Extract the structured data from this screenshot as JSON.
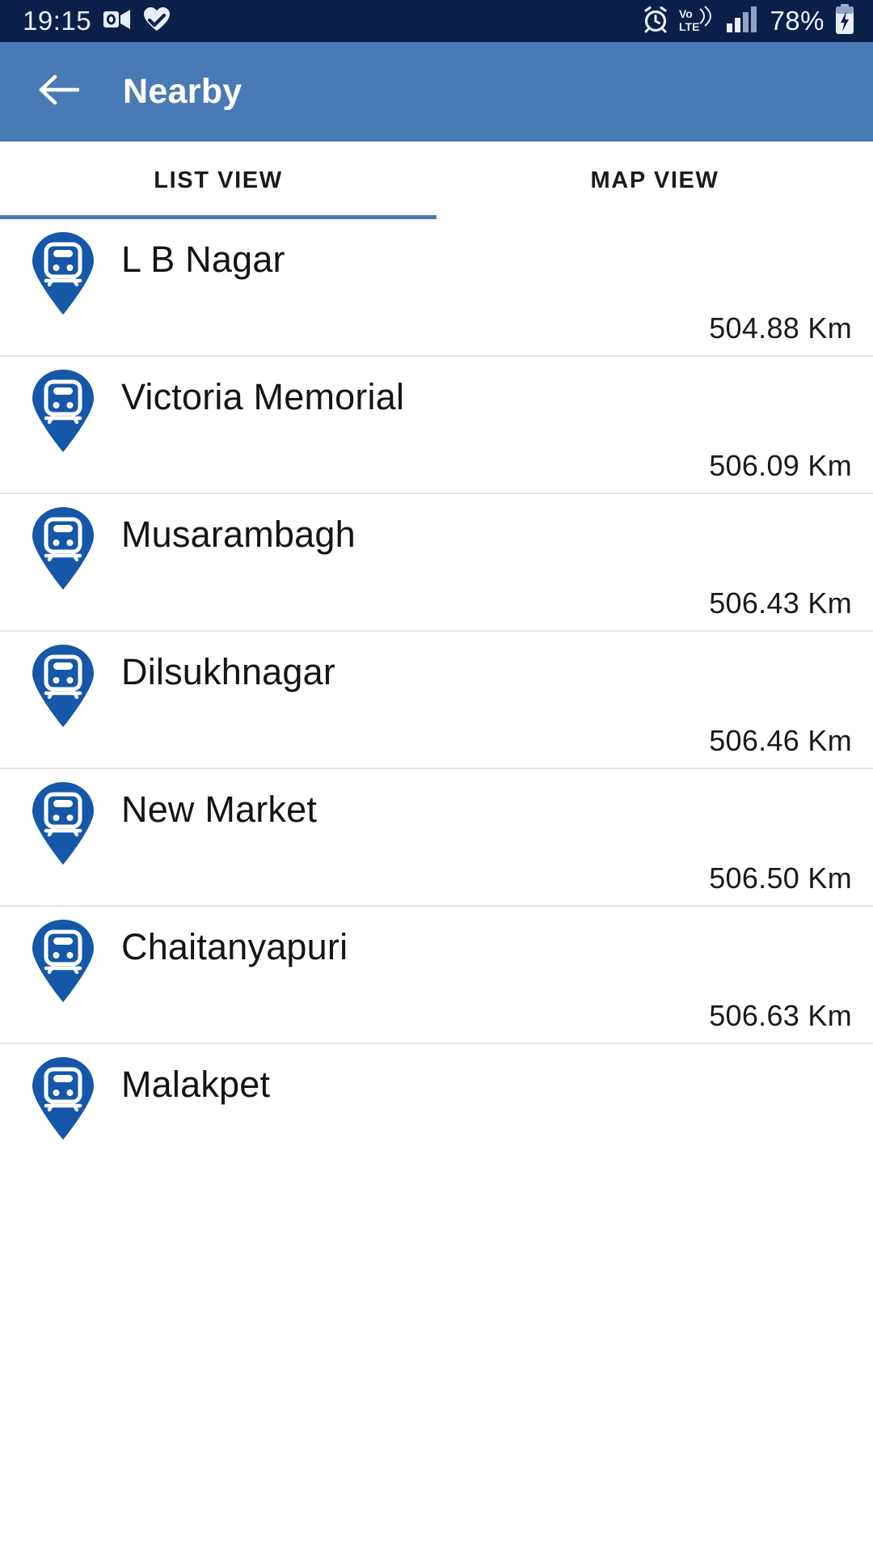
{
  "status_bar": {
    "time": "19:15",
    "battery_percent": "78%",
    "network_type": "Vo LTE",
    "icons": [
      "outlook-icon",
      "heart-health-icon",
      "alarm-icon",
      "volte-icon",
      "signal-bars-icon",
      "battery-charging-icon"
    ],
    "background_color": "#0b2049"
  },
  "app_bar": {
    "title": "Nearby",
    "back_icon": "back-arrow-icon",
    "background_color": "#4a7ab5"
  },
  "tabs": {
    "items": [
      {
        "label": "LIST VIEW",
        "selected": true
      },
      {
        "label": "MAP VIEW",
        "selected": false
      }
    ],
    "indicator_color": "#4a7ab5"
  },
  "list": {
    "pin_color": "#1557a8",
    "pin_icon": "metro-train-pin-icon",
    "items": [
      {
        "name": "L B Nagar",
        "distance": "504.88 Km"
      },
      {
        "name": "Victoria Memorial",
        "distance": "506.09 Km"
      },
      {
        "name": "Musarambagh",
        "distance": "506.43 Km"
      },
      {
        "name": "Dilsukhnagar",
        "distance": "506.46 Km"
      },
      {
        "name": "New Market",
        "distance": "506.50 Km"
      },
      {
        "name": "Chaitanyapuri",
        "distance": "506.63 Km"
      },
      {
        "name": "Malakpet",
        "distance": ""
      }
    ]
  }
}
